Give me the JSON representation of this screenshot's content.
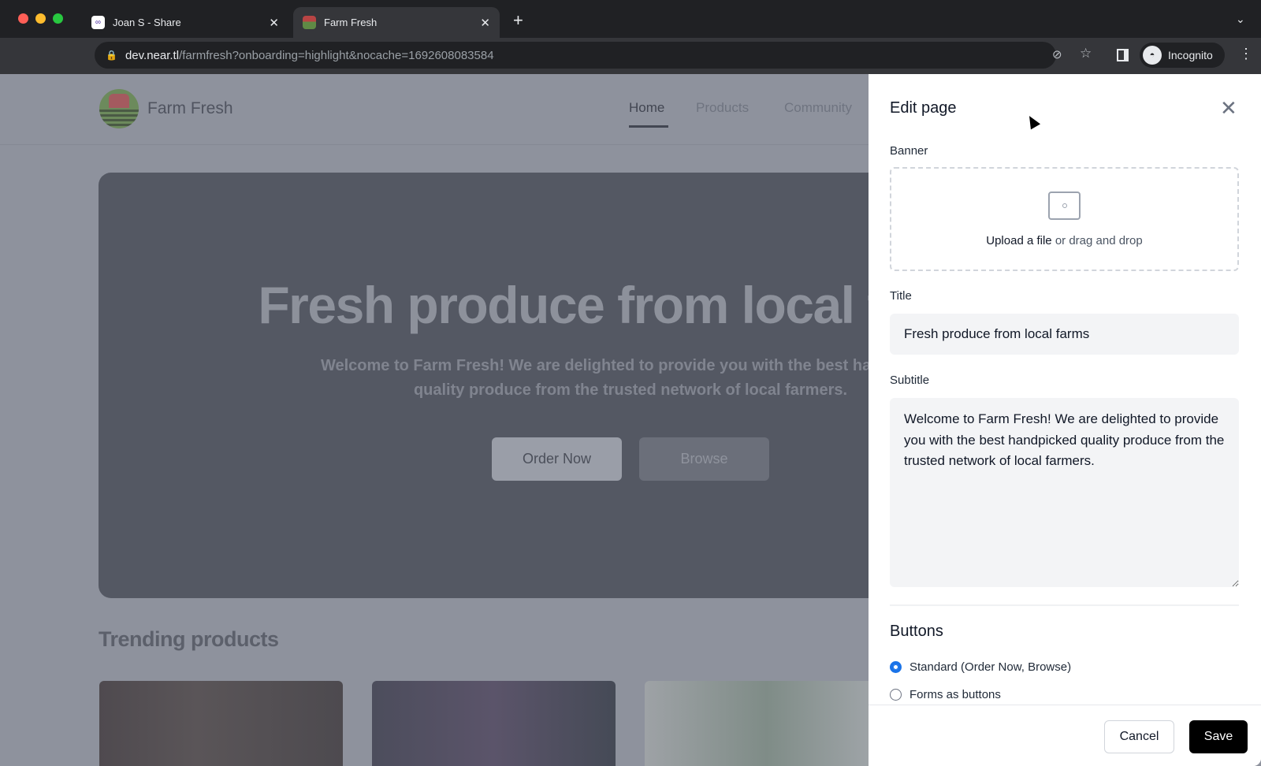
{
  "browser": {
    "tabs": [
      {
        "title": "Joan S - Share",
        "active": false
      },
      {
        "title": "Farm Fresh",
        "active": true
      }
    ],
    "url_host": "dev.near.tl",
    "url_path": "/farmfresh?onboarding=highlight&nocache=1692608083584",
    "profile_label": "Incognito"
  },
  "site": {
    "brand": "Farm Fresh",
    "nav": [
      "Home",
      "Products",
      "Community"
    ],
    "hero_title": "Fresh produce from local farms",
    "hero_subtitle": "Welcome to Farm Fresh! We are delighted to provide you with the best handpicked quality produce from the trusted network of local farmers.",
    "hero_buttons": [
      "Order Now",
      "Browse"
    ],
    "trending_heading": "Trending products"
  },
  "panel": {
    "title": "Edit page",
    "banner_label": "Banner",
    "upload_link": "Upload a file",
    "upload_rest": "or drag and drop",
    "title_label": "Title",
    "title_value": "Fresh produce from local farms",
    "subtitle_label": "Subtitle",
    "subtitle_value": "Welcome to Farm Fresh! We are delighted to provide you with the best handpicked quality produce from the trusted network of local farmers.",
    "buttons_heading": "Buttons",
    "button_options": [
      {
        "label": "Standard (Order Now, Browse)",
        "selected": true
      },
      {
        "label": "Forms as buttons",
        "selected": false
      }
    ],
    "cancel_label": "Cancel",
    "save_label": "Save"
  },
  "colors": {
    "accent": "#1a73e8",
    "save": "#000000"
  }
}
